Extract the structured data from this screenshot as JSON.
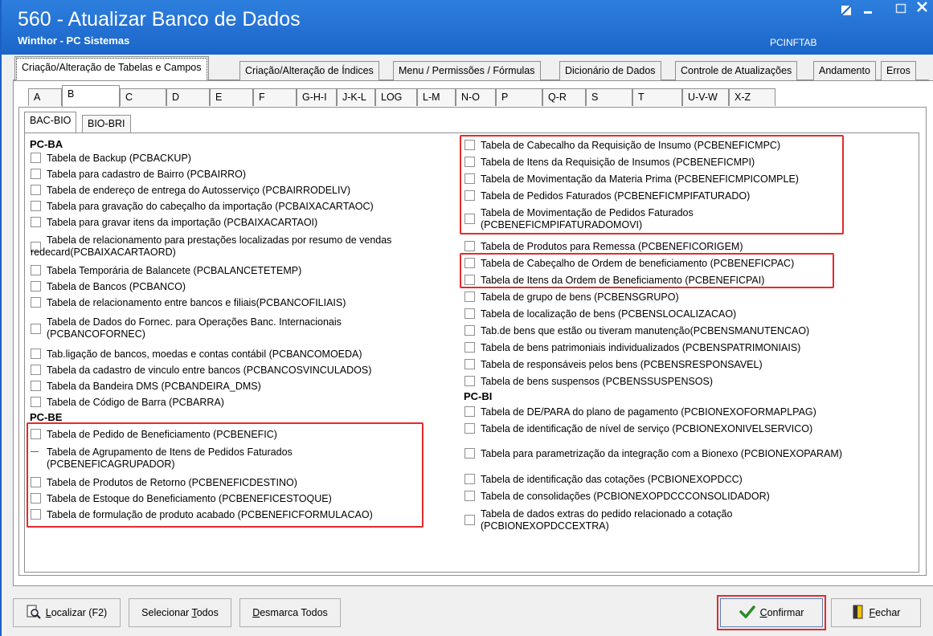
{
  "window": {
    "title": "560 - Atualizar Banco de Dados",
    "subtitle": "Winthor - PC Sistemas",
    "code": "PCINFTAB"
  },
  "main_tabs": [
    "Criação/Alteração de Tabelas e Campos",
    "Criação/Alteração de Índices",
    "Menu / Permissões / Fórmulas",
    "Dicionário de Dados",
    "Controle de Atualizações",
    "Andamento",
    "Erros"
  ],
  "letter_tabs": [
    "A",
    "B",
    "C",
    "D",
    "E",
    "F",
    "G-H-I",
    "J-K-L",
    "LOG",
    "L-M",
    "N-O",
    "P",
    "Q-R",
    "S",
    "T",
    "U-V-W",
    "X-Z"
  ],
  "sub_tabs": [
    "BAC-BIO",
    "BIO-BRI"
  ],
  "left": {
    "group_ba": "PC-BA",
    "group_be": "PC-BE",
    "items": [
      "Tabela de Backup (PCBACKUP)",
      "Tabela para cadastro de Bairro (PCBAIRRO)",
      "Tabela de endereço de entrega do Autosserviço (PCBAIRRODELIV)",
      "Tabela para gravação do cabeçalho da importação (PCBAIXACARTAOC)",
      "Tabela para gravar itens da importação (PCBAIXACARTAOI)",
      "Tabela de relacionamento para prestações localizadas por resumo de vendas",
      "redecard(PCBAIXACARTAORD)",
      "Tabela Temporária de Balancete  (PCBALANCETETEMP)",
      "Tabela de Bancos (PCBANCO)",
      "Tabela de relacionamento entre bancos e filiais(PCBANCOFILIAIS)",
      "Tabela de Dados do Fornec. para Operações Banc. Internacionais",
      "(PCBANCOFORNEC)",
      "Tab.ligação de bancos, moedas e contas contábil (PCBANCOMOEDA)",
      "Tabela da cadastro de vinculo entre bancos (PCBANCOSVINCULADOS)",
      "Tabela da Bandeira DMS (PCBANDEIRA_DMS)",
      "Tabela de Código de Barra (PCBARRA)"
    ],
    "be_items": [
      "Tabela de Pedido de Beneficiamento (PCBENEFIC)",
      "Tabela de Agrupamento de Itens de Pedidos Faturados",
      "(PCBENEFICAGRUPADOR)",
      "Tabela de Produtos de Retorno (PCBENEFICDESTINO)",
      "Tabela de Estoque do Beneficiamento (PCBENEFICESTOQUE)",
      "Tabela de formulação de produto acabado (PCBENEFICFORMULACAO)"
    ]
  },
  "right": {
    "items": [
      "Tabela de Cabecalho da Requisição de Insumo (PCBENEFICMPC)",
      "Tabela de Itens da Requisição de Insumos (PCBENEFICMPI)",
      "Tabela de Movimentação da Materia Prima (PCBENEFICMPICOMPLE)",
      "Tabela de Pedidos Faturados (PCBENEFICMPIFATURADO)",
      "Tabela de Movimentação de Pedidos Faturados",
      "(PCBENEFICMPIFATURADOMOVI)",
      "Tabela de Produtos para Remessa (PCBENEFICORIGEM)",
      "Tabela de Cabeçalho de Ordem de beneficiamento (PCBENEFICPAC)",
      "Tabela de Itens da Ordem de Beneficiamento (PCBENEFICPAI)",
      "Tabela de grupo de bens (PCBENSGRUPO)",
      "Tabela de localização de bens (PCBENSLOCALIZACAO)",
      "Tab.de bens que estão ou tiveram manutenção(PCBENSMANUTENCAO)",
      "Tabela de bens patrimoniais individualizados (PCBENSPATRIMONIAIS)",
      "Tabela de responsáveis pelos bens (PCBENSRESPONSAVEL)",
      "Tabela de bens suspensos (PCBENSSUSPENSOS)"
    ],
    "group_bi": "PC-BI",
    "bi_items": [
      "Tabela de DE/PARA do plano de pagamento (PCBIONEXOFORMAPLPAG)",
      "Tabela de identificação de nível de serviço (PCBIONEXONIVELSERVICO)",
      "Tabela para parametrização da integração com a Bionexo (PCBIONEXOPARAM)",
      "Tabela de identificação das cotações (PCBIONEXOPDCC)",
      "Tabela de consolidações (PCBIONEXOPDCCCONSOLIDADOR)",
      "Tabela de dados extras do pedido relacionado a cotação",
      "(PCBIONEXOPDCCEXTRA)"
    ]
  },
  "buttons": {
    "localizar_u": "L",
    "localizar_rest": "ocalizar (F2)",
    "selecionar_pre": "Selecionar ",
    "selecionar_u": "T",
    "selecionar_rest": "odos",
    "desmarca_u": "D",
    "desmarca_rest": "esmarca Todos",
    "confirmar_u": "C",
    "confirmar_rest": "onfirmar",
    "fechar_u": "F",
    "fechar_rest": "echar"
  },
  "colors": {
    "titlebar": "#1f6fd3",
    "highlight": "#e32b2b",
    "confirm_check": "#2b8a2b"
  }
}
